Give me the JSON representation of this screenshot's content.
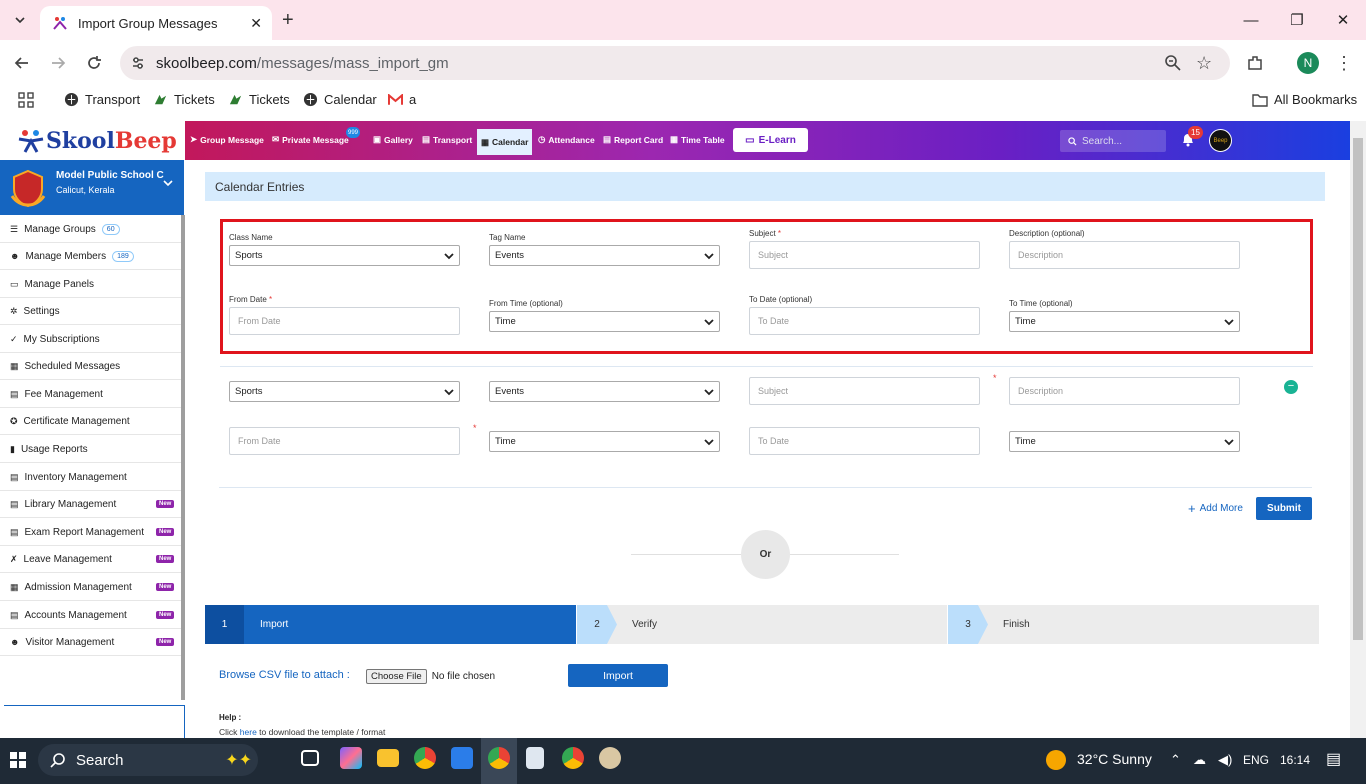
{
  "browser": {
    "tab_title": "Import Group Messages",
    "url_host": "skoolbeep.com",
    "url_path": "/messages/mass_import_gm",
    "bookmarks": [
      "Transport",
      "Tickets",
      "Tickets",
      "Calendar",
      "a"
    ],
    "all_bookmarks": "All Bookmarks",
    "profile_initial": "N"
  },
  "brand": {
    "logo_a": "Skool",
    "logo_b": "Beep"
  },
  "topnav": {
    "items": [
      "Group Message",
      "Private Message",
      "Gallery",
      "Transport",
      "Calendar",
      "Attendance",
      "Report Card",
      "Time Table"
    ],
    "private_badge": "999",
    "elearn": "E-Learn",
    "search_placeholder": "Search...",
    "notification_count": "15"
  },
  "school": {
    "name": "Model Public School C",
    "location": "Calicut, Kerala"
  },
  "sidebar": {
    "items": [
      {
        "label": "Manage Groups",
        "count": "60"
      },
      {
        "label": "Manage Members",
        "count": "189"
      },
      {
        "label": "Manage Panels"
      },
      {
        "label": "Settings"
      },
      {
        "label": "My Subscriptions"
      },
      {
        "label": "Scheduled Messages"
      },
      {
        "label": "Fee Management"
      },
      {
        "label": "Certificate Management"
      },
      {
        "label": "Usage Reports"
      },
      {
        "label": "Inventory Management"
      },
      {
        "label": "Library Management",
        "new": "New"
      },
      {
        "label": "Exam Report Management",
        "new": "New"
      },
      {
        "label": "Leave Management",
        "new": "New"
      },
      {
        "label": "Admission Management",
        "new": "New"
      },
      {
        "label": "Accounts Management",
        "new": "New"
      },
      {
        "label": "Visitor Management",
        "new": "New"
      }
    ]
  },
  "card": {
    "title": "Calendar Entries"
  },
  "form": {
    "labels": {
      "class_name": "Class Name",
      "tag_name": "Tag Name",
      "subject": "Subject",
      "description": "Description (optional)",
      "from_date": "From Date",
      "from_time": "From Time (optional)",
      "to_date": "To Date (optional)",
      "to_time": "To Time (optional)",
      "required_mark": "*"
    },
    "rows": [
      {
        "class_value": "Sports",
        "tag_value": "Events",
        "subject_ph": "Subject",
        "description_ph": "Description",
        "from_date_ph": "From Date",
        "from_time_value": "Time",
        "to_date_ph": "To Date",
        "to_time_value": "Time"
      },
      {
        "class_value": "Sports",
        "tag_value": "Events",
        "subject_ph": "Subject",
        "description_ph": "Description",
        "from_date_ph": "From Date",
        "from_time_value": "Time",
        "to_date_ph": "To Date",
        "to_time_value": "Time"
      }
    ],
    "add_more": "Add More",
    "submit": "Submit",
    "or": "Or"
  },
  "steps": [
    {
      "num": "1",
      "label": "Import"
    },
    {
      "num": "2",
      "label": "Verify"
    },
    {
      "num": "3",
      "label": "Finish"
    }
  ],
  "import": {
    "browse_label": "Browse CSV file to attach :",
    "choose_file": "Choose File",
    "no_file": "No file chosen",
    "button": "Import",
    "help_title": "Help :",
    "help_pre": "Click ",
    "help_link": "here",
    "help_post": " to download the template / format"
  },
  "taskbar": {
    "search": "Search",
    "weather": "32°C  Sunny",
    "lang": "ENG",
    "time": "16:14"
  },
  "colors": {
    "primary": "#1565c0",
    "highlight": "#e0141c",
    "nav_start": "#c2185b",
    "nav_end": "#1a3fe0"
  }
}
